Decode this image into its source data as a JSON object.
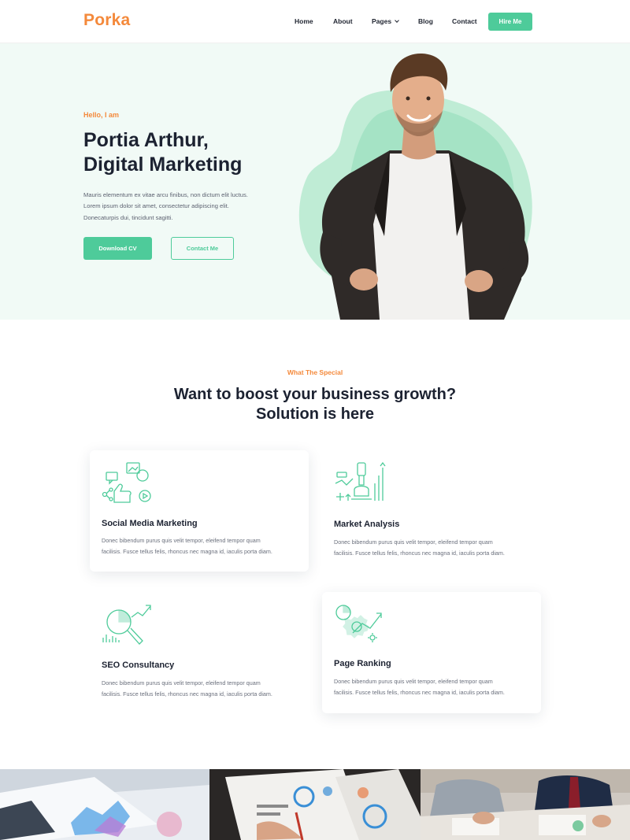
{
  "brand": {
    "logo": "Porka",
    "accent": "#4ecb9a",
    "orange": "#f4893b"
  },
  "nav": {
    "items": [
      "Home",
      "About",
      "Pages",
      "Blog",
      "Contact"
    ],
    "cta": "Hire Me"
  },
  "hero": {
    "eyebrow": "Hello, I am",
    "title_line1": "Portia Arthur,",
    "title_line2": "Digital Marketing",
    "desc_lines": [
      "Mauris elementum ex vitae arcu finibus, non dictum elit luctus.",
      "Lorem ipsum dolor sit amet, consectetur adipiscing elit.",
      "Donecaturpis dui, tincidunt sagitti."
    ],
    "primary_button": "Download CV",
    "secondary_button": "Contact Me"
  },
  "special": {
    "eyebrow": "What The Special",
    "title_line1": "Want to boost your business growth?",
    "title_line2": "Solution is here"
  },
  "services": [
    {
      "title": "Social Media Marketing",
      "icon": "social-media-icon",
      "desc_lines": [
        "Donec bibendum purus quis velit tempor, eleifend tempor quam",
        "facilisis. Fusce tellus felis, rhoncus nec magna id, iaculis porta diam."
      ]
    },
    {
      "title": "Market Analysis",
      "icon": "market-analysis-icon",
      "desc_lines": [
        "Donec bibendum purus quis velit tempor, eleifend tempor quam",
        "facilisis. Fusce tellus felis, rhoncus nec magna id, iaculis porta diam."
      ]
    },
    {
      "title": "SEO Consultancy",
      "icon": "seo-icon",
      "desc_lines": [
        "Donec bibendum purus quis velit tempor, eleifend tempor quam",
        "facilisis. Fusce tellus felis, rhoncus nec magna id, iaculis porta diam."
      ]
    },
    {
      "title": "Page Ranking",
      "icon": "page-ranking-icon",
      "desc_lines": [
        "Donec bibendum purus quis velit tempor, eleifend tempor quam",
        "facilisis. Fusce tellus felis, rhoncus nec magna id, iaculis porta diam."
      ]
    }
  ]
}
